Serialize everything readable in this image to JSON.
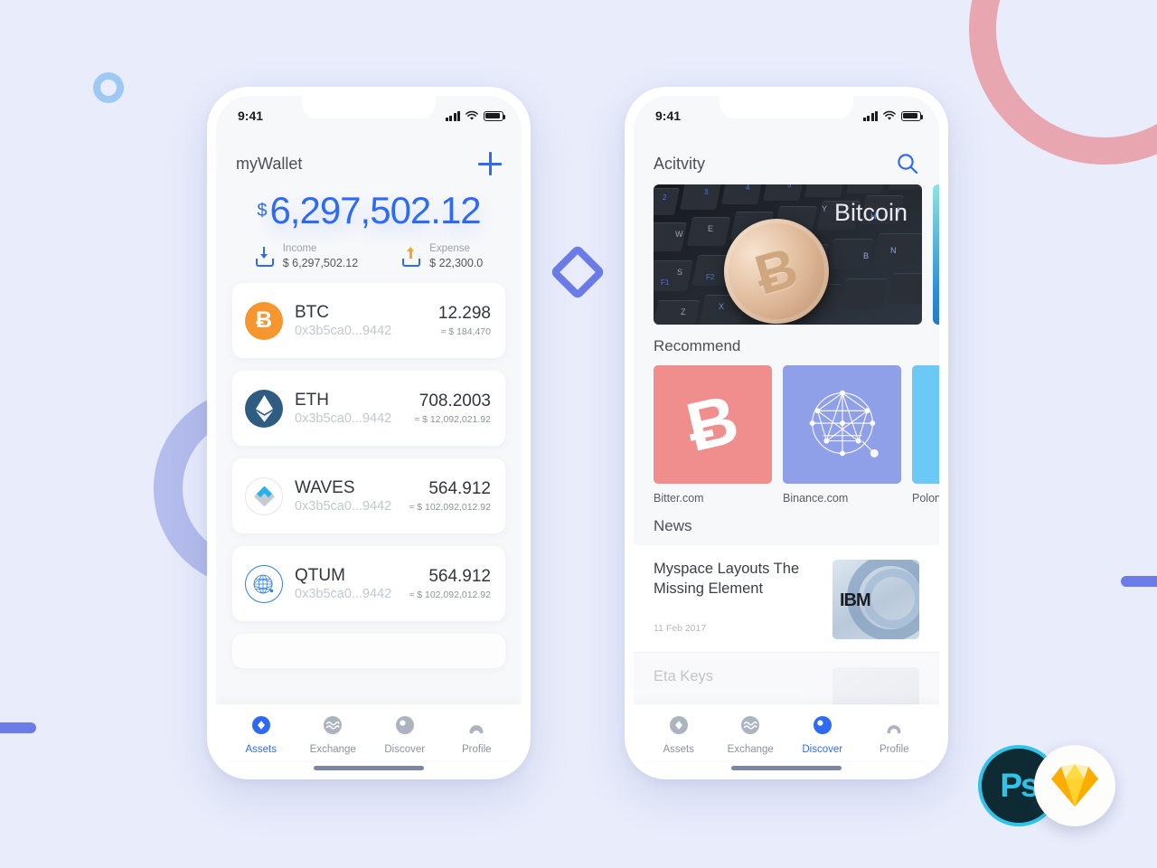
{
  "canvas": {
    "background": "#e8ecfb"
  },
  "decor": {
    "ring_pink": "#e8a7b0",
    "ring_lavender": "#b4bdec",
    "ring_small": "#9fc9f5",
    "diamond": "#6b7ce8",
    "bar": "#6b7ce8"
  },
  "statusbar": {
    "time": "9:41"
  },
  "wallet": {
    "title": "myWallet",
    "add_label": "+",
    "balance_currency": "$",
    "balance": "6,297,502.12",
    "income": {
      "label": "Income",
      "value": "$ 6,297,502.12"
    },
    "expense": {
      "label": "Expense",
      "value": "$ 22,300.0"
    },
    "assets": [
      {
        "symbol": "BTC",
        "glyph": "Ƀ",
        "address": "0x3b5ca0...9442",
        "amount": "12.298",
        "usd": "≈ $ 184,470",
        "color": "#f5962f"
      },
      {
        "symbol": "ETH",
        "glyph": "◆",
        "address": "0x3b5ca0...9442",
        "amount": "708.2003",
        "usd": "≈ $ 12,092,021.92",
        "color": "#2f5d82"
      },
      {
        "symbol": "WAVES",
        "glyph": "",
        "address": "0x3b5ca0...9442",
        "amount": "564.912",
        "usd": "≈ $ 102,092,012.92",
        "color": "#22b4e8"
      },
      {
        "symbol": "QTUM",
        "glyph": "",
        "address": "0x3b5ca0...9442",
        "amount": "564.912",
        "usd": "≈ $ 102,092,012.92",
        "color": "#2f7fe0"
      }
    ]
  },
  "discover": {
    "title": "Acitvity",
    "search_label": "search-icon",
    "banner": {
      "word": "Bitcoin",
      "coin_glyph": "Ƀ"
    },
    "recommend_title": "Recommend",
    "recommend": [
      {
        "label": "Bitter.com",
        "glyph": "Ƀ",
        "color": "#f08e8e"
      },
      {
        "label": "Binance.com",
        "glyph": "",
        "color": "#8f9fe8"
      },
      {
        "label": "Poloniex.com",
        "glyph": "",
        "color": "#6cc8f5"
      }
    ],
    "news_title": "News",
    "news": [
      {
        "title": "Myspace Layouts The Missing Element",
        "date": "11 Feb 2017",
        "logo": "IBM"
      },
      {
        "title": "Eta Keys",
        "date": "",
        "logo": ""
      }
    ]
  },
  "tabbar": {
    "items": [
      {
        "label": "Assets",
        "icon": "assets-icon"
      },
      {
        "label": "Exchange",
        "icon": "exchange-icon"
      },
      {
        "label": "Discover",
        "icon": "discover-icon"
      },
      {
        "label": "Profile",
        "icon": "profile-icon"
      }
    ],
    "active_left": "Assets",
    "active_right": "Discover",
    "accent": "#2f6bf2"
  },
  "badges": {
    "photoshop": "Ps",
    "sketch": "sketch-diamond-icon"
  }
}
